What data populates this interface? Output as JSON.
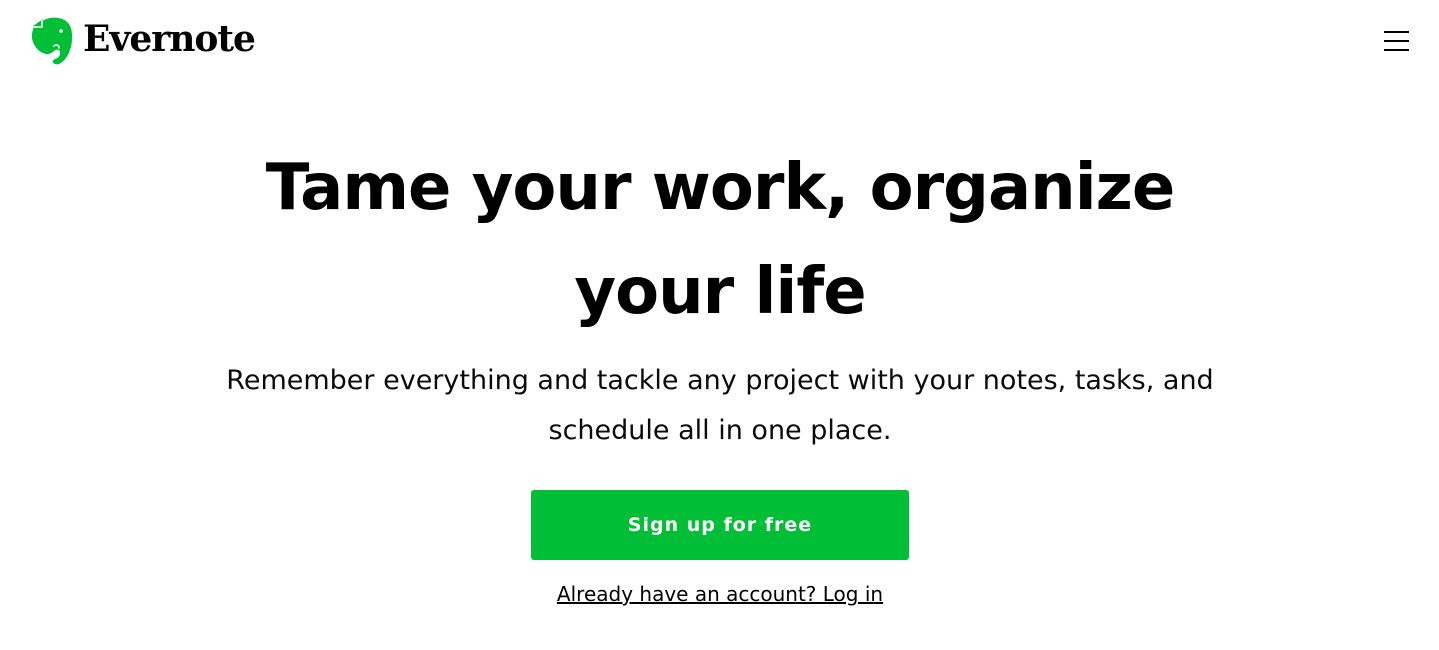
{
  "header": {
    "logo_text": "Evernote",
    "logo_icon": "elephant-logo-icon",
    "menu_icon": "hamburger-menu-icon"
  },
  "hero": {
    "headline": "Tame your work, organize your life",
    "subheadline": "Remember everything and tackle any project with your notes, tasks, and schedule all in one place.",
    "signup_label": "Sign up for free",
    "login_label": "Already have an account? Log in"
  },
  "colors": {
    "brand_green": "#00bf36",
    "text": "#000000",
    "background": "#ffffff"
  }
}
